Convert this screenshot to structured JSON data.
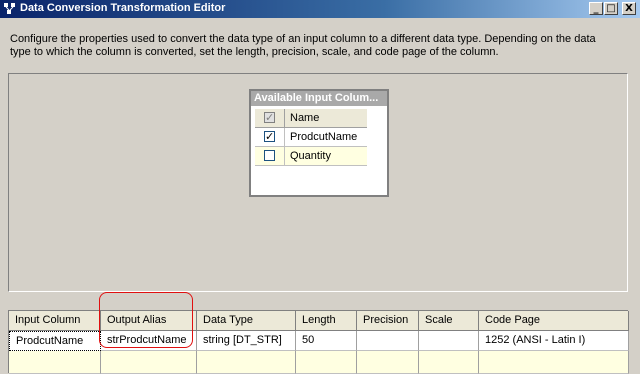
{
  "window": {
    "title": "Data Conversion Transformation Editor",
    "buttons": {
      "minimize": "_",
      "maximize": "□",
      "close": "X"
    }
  },
  "description": "Configure the properties used to convert the data type of an input column to a different data type. Depending on the data\ntype to which the column is converted, set the length, precision, scale, and code page of the column.",
  "available_columns": {
    "title": "Available Input Colum...",
    "header_label": "Name",
    "header_checked": true,
    "rows": [
      {
        "name": "ProdcutName",
        "checked": true
      },
      {
        "name": "Quantity",
        "checked": false
      }
    ]
  },
  "grid": {
    "headers": [
      "Input Column",
      "Output Alias",
      "Data Type",
      "Length",
      "Precision",
      "Scale",
      "Code Page"
    ],
    "rows": [
      [
        "ProdcutName",
        "strProdcutName",
        "string [DT_STR]",
        "50",
        "",
        "",
        "1252  (ANSI - Latin I)"
      ]
    ]
  },
  "colors": {
    "titlebar_start": "#0a246a",
    "highlight": "#e01010",
    "new_row": "#ffffe1"
  }
}
